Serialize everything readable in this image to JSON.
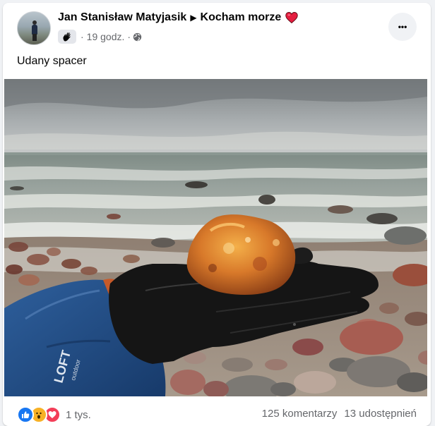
{
  "post": {
    "author": "Jan Stanisław Matyjasik",
    "group": "Kocham morze",
    "time": "19 godz.",
    "dot": "·",
    "more_label": "•••",
    "text": "Udany spacer"
  },
  "photo": {
    "jacket_text_1": "LOFT",
    "jacket_text_2": "outdoor"
  },
  "footer": {
    "reactions_count": "1 tys.",
    "comments": "125 komentarzy",
    "shares": "13 udostępnień"
  },
  "icons": {
    "heart": "heart-icon",
    "globe": "globe-icon",
    "like": "like-reaction-icon",
    "wow": "wow-reaction-icon",
    "love": "love-reaction-icon"
  },
  "colors": {
    "accent": "#1877f2",
    "heart": "#e41e3f",
    "meta": "#65676b"
  }
}
